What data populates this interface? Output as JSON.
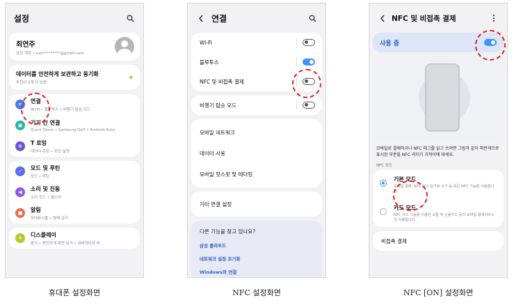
{
  "phone1": {
    "title": "설정",
    "profile": {
      "name": "최연주",
      "sub": "삼성 계정 • yeo*********@gmail.com"
    },
    "backup": {
      "title": "데이터를 안전하게 보관하고 동기화",
      "sub": "추천이 2개 더 있음"
    },
    "items": [
      {
        "title": "연결",
        "sub": "Wi-Fi • 블루투스 • 비행기 탑승 모드",
        "color": "#3e7fe8",
        "icon": "wifi-icon",
        "glyph": "≋"
      },
      {
        "title": "기기 간 연결",
        "sub": "Quick Share • Samsung DeX • Android Auto",
        "color": "#26b5a9",
        "icon": "devices-icon",
        "glyph": "▣"
      },
      {
        "title": "T 로밍",
        "sub": "데이터 로밍 • 로밍 설정",
        "color": "#6b55d8",
        "icon": "globe-icon",
        "glyph": "⊕"
      },
      {
        "title": "모드 및 루틴",
        "sub": "모드 • 루틴",
        "color": "#5b6ee6",
        "icon": "check-icon",
        "glyph": "✓"
      },
      {
        "title": "소리 및 진동",
        "sub": "소리 모드 • 벨소리",
        "color": "#8a5ce6",
        "icon": "sound-icon",
        "glyph": "◀"
      },
      {
        "title": "알림",
        "sub": "상태표시줄 • 방해 금지",
        "color": "#ef6a4f",
        "icon": "bell-icon",
        "glyph": "■"
      },
      {
        "title": "디스플레이",
        "sub": "밝기 • 편안하게 화면 보기 • 내비게이션 바",
        "color": "#b6c92a",
        "icon": "sun-icon",
        "glyph": "☀"
      }
    ]
  },
  "phone2": {
    "title": "연결",
    "rows": [
      {
        "label": "Wi-Fi",
        "state": "off"
      },
      {
        "label": "블루투스",
        "state": "on"
      },
      {
        "label": "NFC 및 비접촉 결제",
        "state": "off"
      }
    ],
    "airplane": {
      "label": "비행기 탑승 모드",
      "state": "off"
    },
    "group": [
      "모바일 네트워크",
      "데이터 사용",
      "모바일 핫스팟 및 테더링"
    ],
    "other": "기타 연결 설정",
    "suggest": {
      "question": "다른 기능을 찾고 있나요?",
      "links": [
        "삼성 클라우드",
        "네트워크 설정 초기화",
        "Windows와 연결"
      ]
    }
  },
  "phone3": {
    "title": "NFC 및 비접촉 결제",
    "use_label": "사용 중",
    "description": "모바일로 결제하거나 NFC 태그를 읽고 쓰려면 그림과 같이 파란색으로 표시된 부분을 NFC 리더기 가까이에 대세요.",
    "section": "NFC 모드",
    "modes": [
      {
        "title": "기본 모드",
        "sub": "모바일 결제, NFC 태그 읽기와 쓰기 등 모든 NFC 기능을 사용합니다.",
        "selected": true
      },
      {
        "title": "카드 모드",
        "sub": "NFC 카드 기능을 이용한 교통 및 신용카드 등의 모바일 결제서비스만 사용합니다.",
        "selected": false
      }
    ],
    "contactless": "비접촉 결제"
  },
  "captions": [
    "휴대폰 설정화면",
    "NFC 설정화면",
    "NFC [ON] 설정화면"
  ],
  "colors": {
    "accent": "#3e91ff",
    "highlight": "#e02020"
  }
}
